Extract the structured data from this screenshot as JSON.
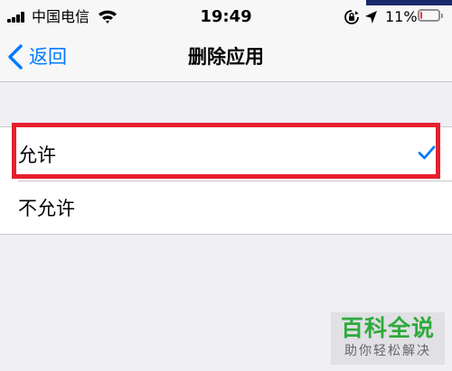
{
  "status_bar": {
    "carrier": "中国电信",
    "time": "19:49",
    "battery_percent": "11%",
    "battery_level": 0.11,
    "battery_color": "#ff3b30",
    "icons": [
      "signal-icon",
      "wifi-icon",
      "orientation-lock-icon",
      "location-icon",
      "battery-icon"
    ]
  },
  "nav": {
    "back_label": "返回",
    "title": "删除应用",
    "accent": "#007aff"
  },
  "options": [
    {
      "label": "允许",
      "selected": true
    },
    {
      "label": "不允许",
      "selected": false
    }
  ],
  "annotation": {
    "highlight_color": "#e5202e"
  },
  "watermark": {
    "title": "百科全说",
    "subtitle": "助你轻松解决",
    "color": "#2eaa3a"
  }
}
